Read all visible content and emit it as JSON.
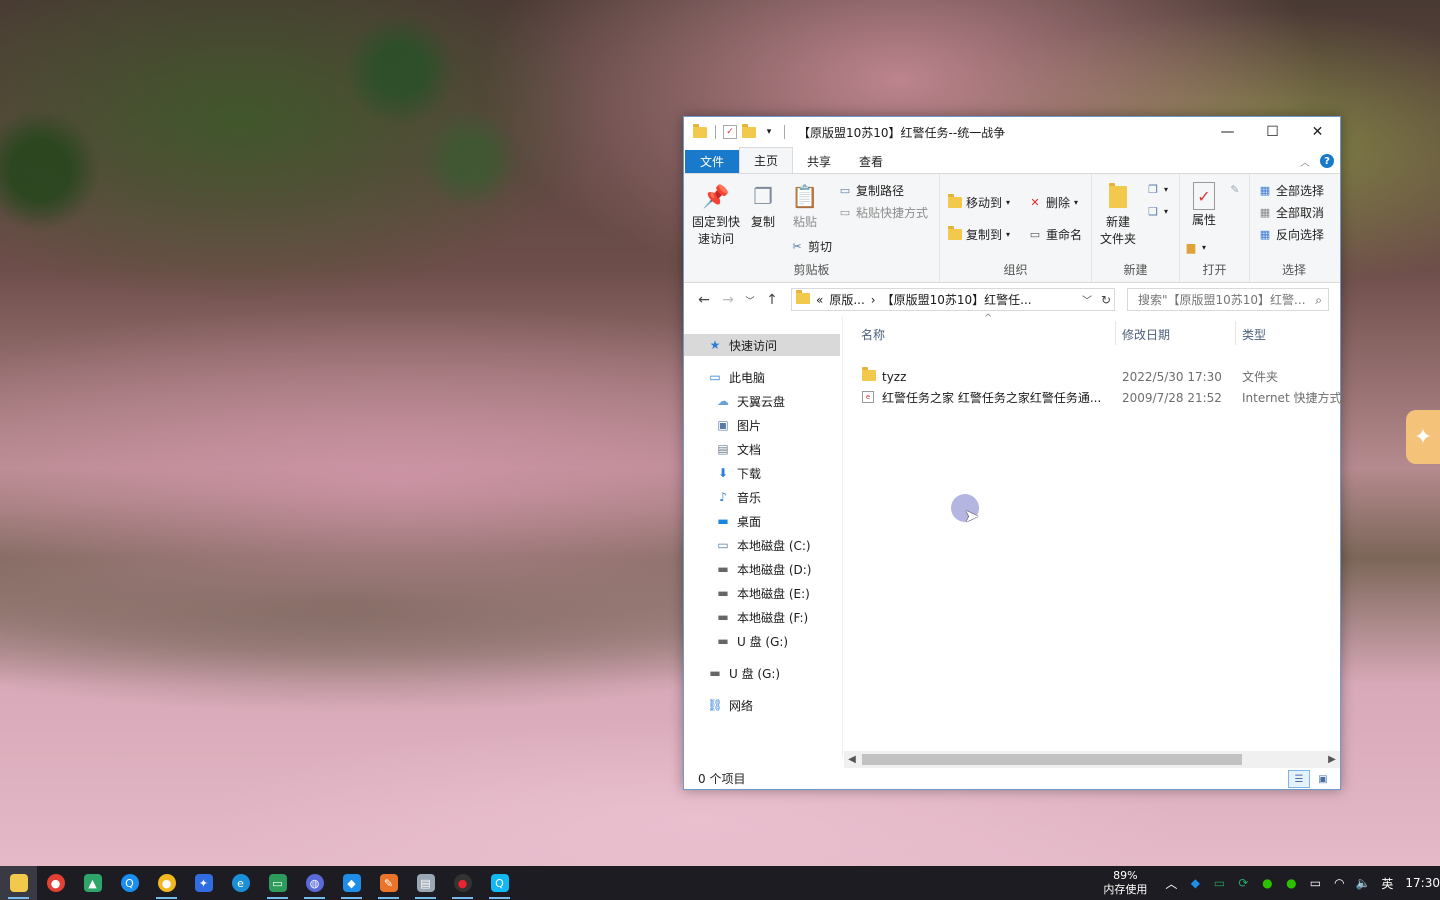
{
  "window": {
    "title": "【原版盟10苏10】红警任务--统一战争",
    "controls": {
      "minimize": "—",
      "maximize": "☐",
      "close": "✕"
    }
  },
  "ribbon": {
    "tabs": [
      "文件",
      "主页",
      "共享",
      "查看"
    ],
    "active_tab": "主页",
    "groups": {
      "clipboard": {
        "label": "剪贴板",
        "pin": "固定到快速访问",
        "pin_line1": "固定到快",
        "pin_line2": "速访问",
        "copy": "复制",
        "paste": "粘贴",
        "copy_path": "复制路径",
        "paste_shortcut": "粘贴快捷方式",
        "cut": "剪切"
      },
      "organize": {
        "label": "组织",
        "move_to": "移动到",
        "copy_to": "复制到",
        "delete": "删除",
        "rename": "重命名"
      },
      "new": {
        "label": "新建",
        "new_folder_line1": "新建",
        "new_folder_line2": "文件夹"
      },
      "open": {
        "label": "打开",
        "properties": "属性"
      },
      "select": {
        "label": "选择",
        "select_all": "全部选择",
        "select_none": "全部取消",
        "invert": "反向选择"
      }
    }
  },
  "address": {
    "prefix": "«",
    "crumb1": "原版...",
    "crumb2": "【原版盟10苏10】红警任...",
    "search_placeholder": "搜索\"【原版盟10苏10】红警..."
  },
  "nav_pane": {
    "quick_access": "快速访问",
    "this_pc": "此电脑",
    "items": [
      "天翼云盘",
      "图片",
      "文档",
      "下载",
      "音乐",
      "桌面",
      "本地磁盘 (C:)",
      "本地磁盘 (D:)",
      "本地磁盘 (E:)",
      "本地磁盘 (F:)",
      "U 盘 (G:)"
    ],
    "usb": "U 盘 (G:)",
    "network": "网络"
  },
  "columns": {
    "name": "名称",
    "date": "修改日期",
    "type": "类型"
  },
  "files": [
    {
      "name": "tyzz",
      "date": "2022/5/30 17:30",
      "type": "文件夹",
      "icon": "folder-icon"
    },
    {
      "name": "红警任务之家 红警任务之家红警任务通...",
      "date": "2009/7/28 21:52",
      "type": "Internet 快捷方式",
      "icon": "internet-shortcut-icon"
    }
  ],
  "status": {
    "count": "0 个项目"
  },
  "taskbar": {
    "apps": [
      "file-explorer",
      "chrome",
      "greenapp",
      "qq-browser",
      "chrome-2",
      "feishu",
      "edge",
      "monitor",
      "globe",
      "app-blue",
      "app-orange",
      "notes",
      "recorder",
      "qq"
    ],
    "memory_percent": "89%",
    "memory_label": "内存使用",
    "ime": "英",
    "time": "17:30"
  },
  "colors": {
    "accent": "#1979ca",
    "selection": "#cce8ff",
    "taskbar": "#1c1c22"
  }
}
